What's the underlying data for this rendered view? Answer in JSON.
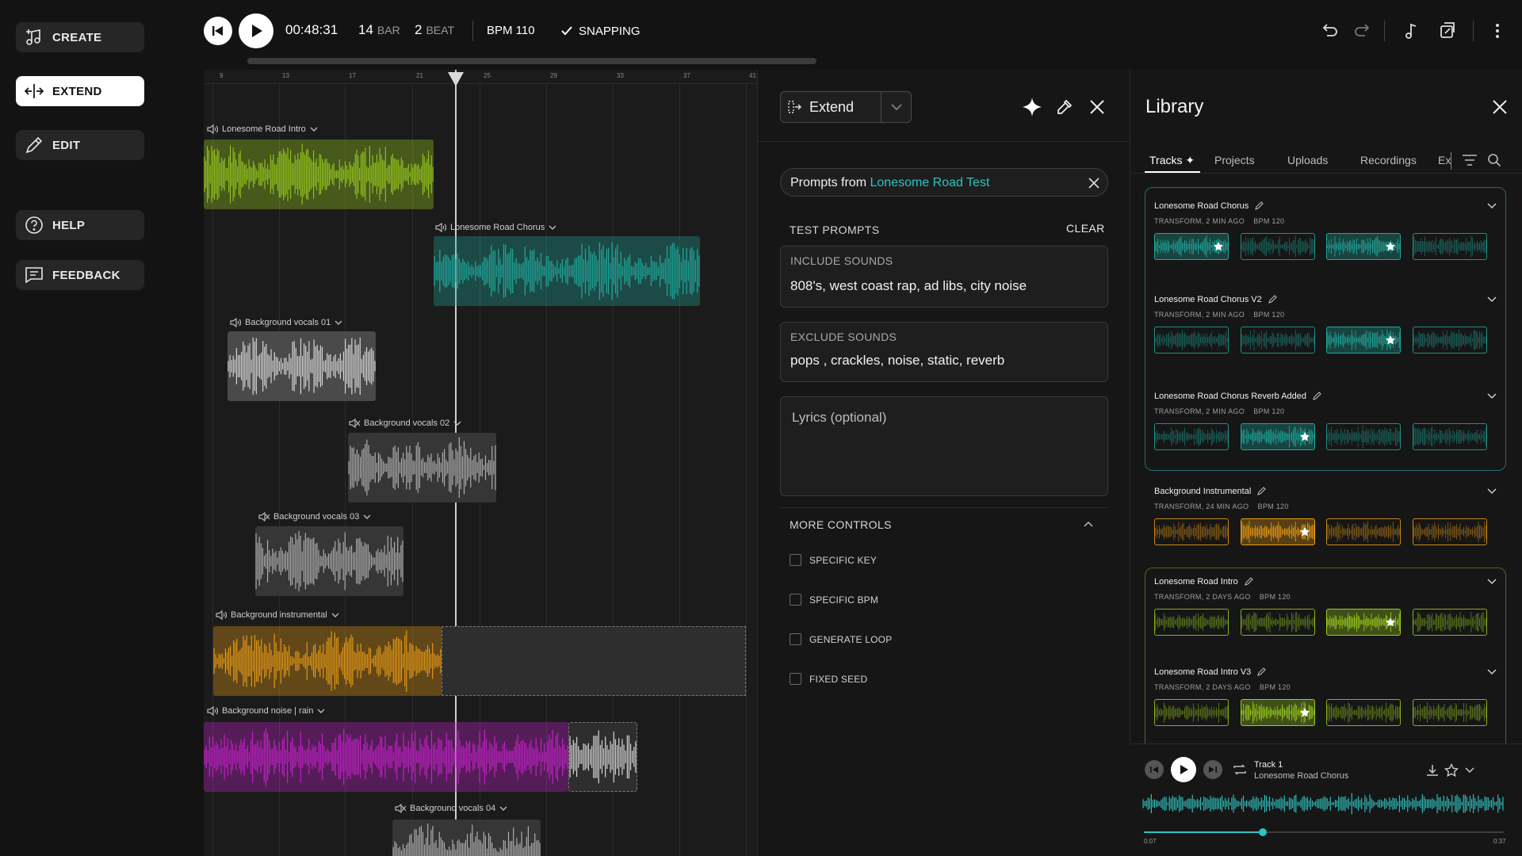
{
  "nav": {
    "create": "CREATE",
    "extend": "EXTEND",
    "edit": "EDIT",
    "help": "HELP",
    "feedback": "FEEDBACK"
  },
  "transport": {
    "time": "00:48:31",
    "bar_value": "14",
    "bar_label": "BAR",
    "beat_value": "2",
    "beat_label": "BEAT",
    "bpm": "BPM 110",
    "snapping": "SNAPPING"
  },
  "timeline": {
    "ruler": [
      "9",
      "13",
      "17",
      "21",
      "25",
      "29",
      "33",
      "37",
      "41"
    ],
    "tracks": [
      {
        "name": "Lonesome Road Intro",
        "color": "#9acd1e",
        "muted": false
      },
      {
        "name": "Lonesome Road Chorus",
        "color": "#1fa79b",
        "muted": false
      },
      {
        "name": "Background vocals 01",
        "color": "#d9d9d9",
        "muted": false
      },
      {
        "name": "Background vocals 02",
        "color": "#d9d9d9",
        "muted": true
      },
      {
        "name": "Background vocals 03",
        "color": "#d9d9d9",
        "muted": true
      },
      {
        "name": "Background instrumental",
        "color": "#e79a16",
        "muted": false
      },
      {
        "name": "Background noise | rain",
        "color": "#c221c8",
        "muted": false
      },
      {
        "name": "Background vocals 04",
        "color": "#d9d9d9",
        "muted": true
      }
    ]
  },
  "extend_panel": {
    "mode": "Extend",
    "prompts_from_prefix": "Prompts from",
    "prompts_from_link": "Lonesome Road Test",
    "test_prompts": "TEST PROMPTS",
    "clear": "CLEAR",
    "include_label": "INCLUDE SOUNDS",
    "include_value": "808's, west coast rap, ad libs, city noise",
    "exclude_label": "EXCLUDE SOUNDS",
    "exclude_value": "pops , crackles, noise, static, reverb",
    "lyrics_placeholder": "Lyrics (optional)",
    "more_controls": "MORE CONTROLS",
    "controls": [
      "SPECIFIC KEY",
      "SPECIFIC BPM",
      "GENERATE LOOP",
      "FIXED SEED"
    ],
    "accent": "#2fc3c0"
  },
  "library": {
    "title": "Library",
    "tabs": [
      "Tracks",
      "Projects",
      "Uploads",
      "Recordings",
      "Ex"
    ],
    "cards": [
      {
        "title": "Lonesome Road Chorus",
        "meta": "TRANSFORM, 2 MIN AGO    BPM 120",
        "color": "#1fa79b",
        "starred": [
          0,
          2
        ],
        "selected": [
          0,
          2
        ]
      },
      {
        "title": "Lonesome Road Chorus V2",
        "meta": "TRANSFORM, 2 MIN AGO    BPM 120",
        "color": "#1fa79b",
        "starred": [
          2
        ],
        "selected": [
          2
        ]
      },
      {
        "title": "Lonesome Road Chorus Reverb Added",
        "meta": "TRANSFORM, 2 MIN AGO    BPM 120",
        "color": "#1fa79b",
        "starred": [
          1
        ],
        "selected": [
          1
        ]
      },
      {
        "title": "Background Instrumental",
        "meta": "TRANSFORM, 24 MIN AGO    BPM 120",
        "color": "#e79a16",
        "starred": [
          1
        ],
        "selected": [
          1
        ]
      },
      {
        "title": "Lonesome Road Intro",
        "meta": "TRANSFORM, 2 DAYS AGO    BPM 120",
        "color": "#9acd1e",
        "starred": [
          2
        ],
        "selected": [
          2
        ]
      },
      {
        "title": "Lonesome Road Intro V3",
        "meta": "TRANSFORM, 2 DAYS AGO    BPM 120",
        "color": "#9acd1e",
        "starred": [
          1
        ],
        "selected": [
          1
        ]
      }
    ]
  },
  "player": {
    "track": "Track 1",
    "subtitle": "Lonesome Road Chorus",
    "elapsed": "0:07",
    "total": "0:37",
    "progress": 0.33,
    "color": "#2fc3c0"
  }
}
